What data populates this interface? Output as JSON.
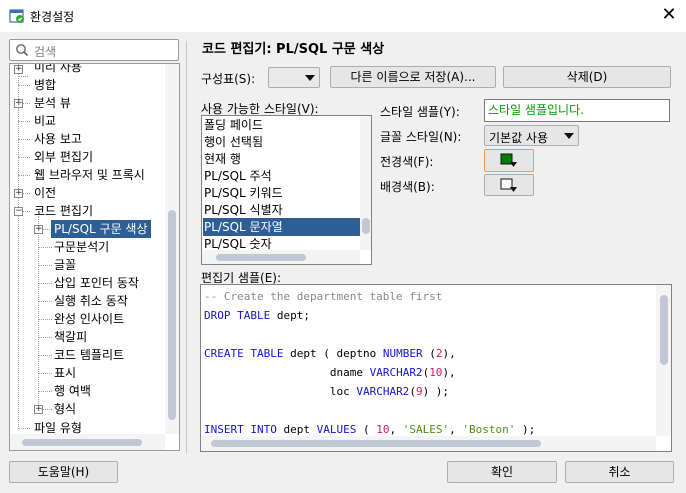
{
  "window": {
    "title": "환경설정",
    "close_glyph": "✕"
  },
  "search": {
    "placeholder": "검색"
  },
  "tree": {
    "items": [
      {
        "label": "미리 사용",
        "expand": "+"
      },
      {
        "label": "병합",
        "expand": ""
      },
      {
        "label": "분석 뷰",
        "expand": "+"
      },
      {
        "label": "비교",
        "expand": ""
      },
      {
        "label": "사용 보고",
        "expand": ""
      },
      {
        "label": "외부 편집기",
        "expand": ""
      },
      {
        "label": "웹 브라우저 및 프록시",
        "expand": ""
      },
      {
        "label": "이전",
        "expand": "+"
      },
      {
        "label": "코드 편집기",
        "expand": "−"
      },
      {
        "label": "PL/SQL 구문 색상",
        "expand": "+"
      },
      {
        "label": "구문분석기",
        "expand": ""
      },
      {
        "label": "글꼴",
        "expand": ""
      },
      {
        "label": "삽입 포인터 동작",
        "expand": ""
      },
      {
        "label": "실행 취소 동작",
        "expand": ""
      },
      {
        "label": "완성 인사이트",
        "expand": ""
      },
      {
        "label": "책갈피",
        "expand": ""
      },
      {
        "label": "코드 템플리트",
        "expand": ""
      },
      {
        "label": "표시",
        "expand": ""
      },
      {
        "label": "행 여백",
        "expand": ""
      },
      {
        "label": "형식",
        "expand": "+"
      },
      {
        "label": "파일 유형",
        "expand": ""
      }
    ]
  },
  "panel": {
    "title": "코드 편집기: PL/SQL 구문 색상",
    "scheme_label": "구성표(S):",
    "scheme_value": "",
    "save_as_button": "다른 이름으로 저장(A)...",
    "delete_button": "삭제(D)",
    "available_styles_label": "사용 가능한 스타일(V):",
    "styles": [
      "폴딩 페이드",
      "행이 선택됨",
      "현재 행",
      "PL/SQL 주석",
      "PL/SQL 키워드",
      "PL/SQL 식별자",
      "PL/SQL 문자열",
      "PL/SQL 숫자"
    ],
    "style_sample_label": "스타일 샘플(Y):",
    "style_sample_text": "스타일 샘플입니다.",
    "font_style_label": "글꼴 스타일(N):",
    "font_style_value": "기본값 사용",
    "foreground_label": "전경색(F):",
    "background_label": "배경색(B):",
    "foreground_color": "#008000",
    "background_color": "#ffffff",
    "editor_sample_label": "편집기 샘플(E):",
    "code": {
      "l1": "-- Create the department table first",
      "l2_kw1": "DROP",
      "l2_kw2": "TABLE",
      "l2_rest": " dept;",
      "l3_kw1": "CREATE",
      "l3_kw2": "TABLE",
      "l3_a": " dept ( deptno ",
      "l3_kw3": "NUMBER",
      "l3_b": " (",
      "l3_n": "2",
      "l3_c": "),",
      "l4_a": "                   dname ",
      "l4_kw": "VARCHAR2",
      "l4_b": "(",
      "l4_n": "10",
      "l4_c": "),",
      "l5_a": "                   loc ",
      "l5_kw": "VARCHAR2",
      "l5_b": "(",
      "l5_n": "9",
      "l5_c": ") );",
      "l6_kw1": "INSERT",
      "l6_kw2": "INTO",
      "l6_a": " dept ",
      "l6_kw3": "VALUES",
      "l6_b": " ( ",
      "l6_n": "10",
      "l6_c": ", ",
      "l6_s1": "'SALES'",
      "l6_d": ", ",
      "l6_s2": "'Boston'",
      "l6_e": " );"
    }
  },
  "footer": {
    "help_button": "도움말(H)",
    "ok_button": "확인",
    "cancel_button": "취소"
  }
}
